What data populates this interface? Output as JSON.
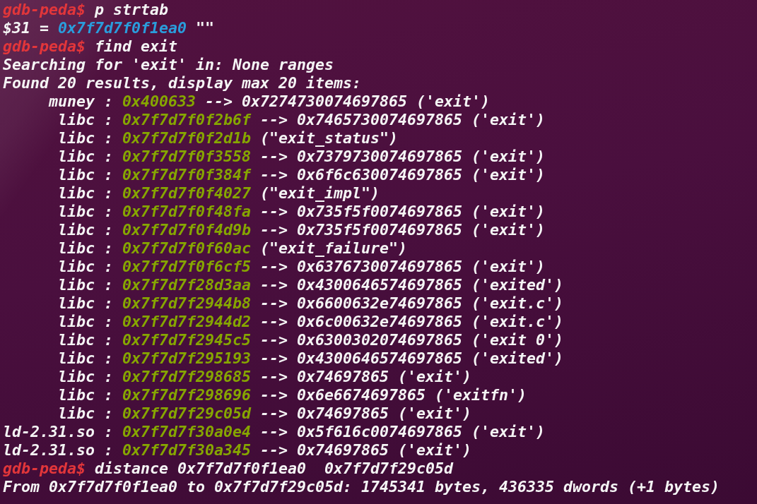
{
  "terminal": {
    "lines": [
      {
        "kind": "command",
        "prompt": "gdb-peda$",
        "text": "p strtab"
      },
      {
        "kind": "value",
        "parts": [
          {
            "kind": "text",
            "text": "$31 ="
          },
          {
            "kind": "pointer",
            "text": "0x7f7d7f0f1ea0"
          },
          {
            "kind": "text",
            "text": "\"\""
          }
        ]
      },
      {
        "kind": "command",
        "prompt": "gdb-peda$",
        "text": "find exit"
      },
      {
        "kind": "output",
        "text": "Searching for 'exit' in: None ranges"
      },
      {
        "kind": "output",
        "text": "Found 20 results, display max 20 items:"
      },
      {
        "kind": "result",
        "label": "muney :",
        "address": "0x400633",
        "detail": "--> 0x7274730074697865 ('exit')"
      },
      {
        "kind": "result",
        "label": "libc :",
        "address": "0x7f7d7f0f2b6f",
        "detail": "--> 0x7465730074697865 ('exit')"
      },
      {
        "kind": "result",
        "label": "libc :",
        "address": "0x7f7d7f0f2d1b",
        "detail": "(\"exit_status\")"
      },
      {
        "kind": "result",
        "label": "libc :",
        "address": "0x7f7d7f0f3558",
        "detail": "--> 0x7379730074697865 ('exit')"
      },
      {
        "kind": "result",
        "label": "libc :",
        "address": "0x7f7d7f0f384f",
        "detail": "--> 0x6f6c630074697865 ('exit')"
      },
      {
        "kind": "result",
        "label": "libc :",
        "address": "0x7f7d7f0f4027",
        "detail": "(\"exit_impl\")"
      },
      {
        "kind": "result",
        "label": "libc :",
        "address": "0x7f7d7f0f48fa",
        "detail": "--> 0x735f5f0074697865 ('exit')"
      },
      {
        "kind": "result",
        "label": "libc :",
        "address": "0x7f7d7f0f4d9b",
        "detail": "--> 0x735f5f0074697865 ('exit')"
      },
      {
        "kind": "result",
        "label": "libc :",
        "address": "0x7f7d7f0f60ac",
        "detail": "(\"exit_failure\")"
      },
      {
        "kind": "result",
        "label": "libc :",
        "address": "0x7f7d7f0f6cf5",
        "detail": "--> 0x6376730074697865 ('exit')"
      },
      {
        "kind": "result",
        "label": "libc :",
        "address": "0x7f7d7f28d3aa",
        "detail": "--> 0x4300646574697865 ('exited')"
      },
      {
        "kind": "result",
        "label": "libc :",
        "address": "0x7f7d7f2944b8",
        "detail": "--> 0x6600632e74697865 ('exit.c')"
      },
      {
        "kind": "result",
        "label": "libc :",
        "address": "0x7f7d7f2944d2",
        "detail": "--> 0x6c00632e74697865 ('exit.c')"
      },
      {
        "kind": "result",
        "label": "libc :",
        "address": "0x7f7d7f2945c5",
        "detail": "--> 0x6300302074697865 ('exit 0')"
      },
      {
        "kind": "result",
        "label": "libc :",
        "address": "0x7f7d7f295193",
        "detail": "--> 0x4300646574697865 ('exited')"
      },
      {
        "kind": "result",
        "label": "libc :",
        "address": "0x7f7d7f298685",
        "detail": "--> 0x74697865 ('exit')"
      },
      {
        "kind": "result",
        "label": "libc :",
        "address": "0x7f7d7f298696",
        "detail": "--> 0x6e6674697865 ('exitfn')"
      },
      {
        "kind": "result",
        "label": "libc :",
        "address": "0x7f7d7f29c05d",
        "detail": "--> 0x74697865 ('exit')"
      },
      {
        "kind": "result",
        "label": "ld-2.31.so :",
        "address": "0x7f7d7f30a0e4",
        "detail": "--> 0x5f616c0074697865 ('exit')"
      },
      {
        "kind": "result",
        "label": "ld-2.31.so :",
        "address": "0x7f7d7f30a345",
        "detail": "--> 0x74697865 ('exit')"
      },
      {
        "kind": "command",
        "prompt": "gdb-peda$",
        "text": "distance 0x7f7d7f0f1ea0  0x7f7d7f29c05d"
      },
      {
        "kind": "output",
        "text": "From 0x7f7d7f0f1ea0 to 0x7f7d7f29c05d: 1745341 bytes, 436335 dwords (+1 bytes)"
      }
    ]
  }
}
